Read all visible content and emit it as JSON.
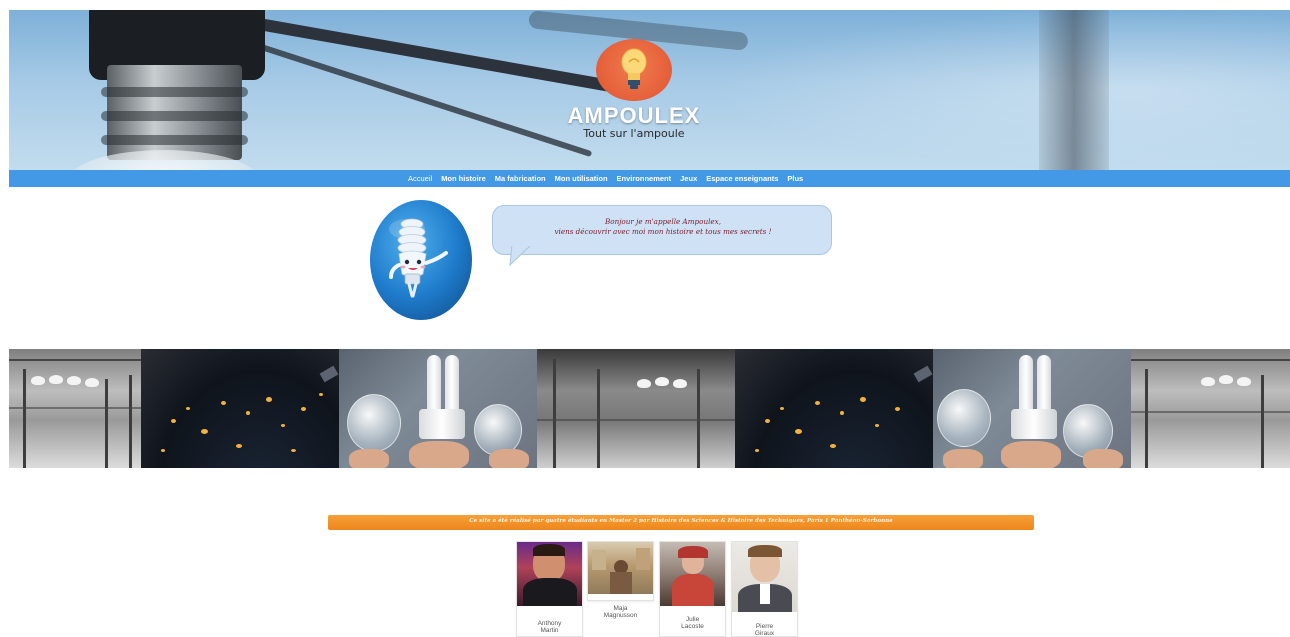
{
  "header": {
    "title": "AMPOULEX",
    "subtitle": "Tout sur l'ampoule",
    "logo_icon": "lightbulb-logo-icon",
    "colors": {
      "logo_circle": "#e5603a",
      "nav_bar": "#4499e6"
    }
  },
  "nav": {
    "items": [
      {
        "label": "Accueil",
        "active": true
      },
      {
        "label": "Mon histoire"
      },
      {
        "label": "Ma fabrication"
      },
      {
        "label": "Mon utilisation"
      },
      {
        "label": "Environnement"
      },
      {
        "label": "Jeux"
      },
      {
        "label": "Espace enseignants"
      },
      {
        "label": "Plus"
      }
    ]
  },
  "mascot": {
    "icon": "cfl-bulb-mascot-icon",
    "speech_line1": "Bonjour je m'appelle Ampoulex,",
    "speech_line2": "viens découvrir avec moi mon histoire et tous mes secrets !"
  },
  "gallery": {
    "images": [
      "lit-store-photo",
      "earth-at-night-photo",
      "bulbs-in-hands-photo",
      "lit-store-photo",
      "earth-at-night-photo",
      "bulbs-in-hands-photo",
      "lit-store-photo"
    ]
  },
  "credits": {
    "text": "Ce site a été réalisé par quatre étudiants en Master 2 par Histoire des Sciences & Histoire des Techniques, Paris 1 Panthéon-Sorbonne",
    "bar_color": "#ee861a",
    "team": [
      {
        "first": "Anthony",
        "last": "Martin"
      },
      {
        "first": "Maja",
        "last": "Magnusson"
      },
      {
        "first": "Julie",
        "last": "Lacoste"
      },
      {
        "first": "Pierre",
        "last": "Giraux"
      }
    ]
  }
}
